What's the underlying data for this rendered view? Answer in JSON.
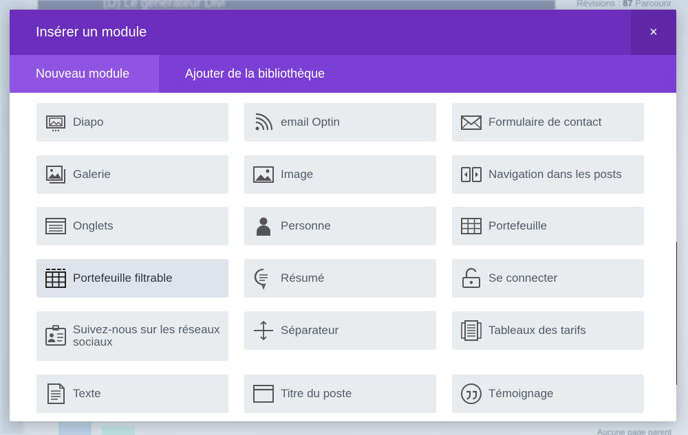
{
  "background": {
    "topbar_text": "(D) Le générateur Divi",
    "revisions_label": "Révisions",
    "revisions_count": "87",
    "revisions_more": "Parcourir",
    "bottom_note": "Aucune page parent"
  },
  "modal": {
    "title": "Insérer un module",
    "close_label": "×",
    "tabs": [
      {
        "label": "Nouveau module",
        "active": true
      },
      {
        "label": "Ajouter de la bibliothèque",
        "active": false
      }
    ],
    "modules": [
      {
        "label": "Diapo",
        "icon": "slider-icon"
      },
      {
        "label": "email Optin",
        "icon": "rss-icon"
      },
      {
        "label": "Formulaire de contact",
        "icon": "envelope-icon"
      },
      {
        "label": "Galerie",
        "icon": "gallery-icon"
      },
      {
        "label": "Image",
        "icon": "image-icon"
      },
      {
        "label": "Navigation dans les posts",
        "icon": "post-navigation-icon"
      },
      {
        "label": "Onglets",
        "icon": "tabs-icon"
      },
      {
        "label": "Personne",
        "icon": "person-icon"
      },
      {
        "label": "Portefeuille",
        "icon": "grid-icon"
      },
      {
        "label": "Portefeuille filtrable",
        "icon": "filterable-grid-icon",
        "selected": true
      },
      {
        "label": "Résumé",
        "icon": "speech-bubble-icon"
      },
      {
        "label": "Se connecter",
        "icon": "unlock-icon"
      },
      {
        "label": "Suivez-nous sur les réseaux sociaux",
        "icon": "social-follow-icon"
      },
      {
        "label": "Séparateur",
        "icon": "divider-icon"
      },
      {
        "label": "Tableaux des tarifs",
        "icon": "pricing-table-icon"
      },
      {
        "label": "Texte",
        "icon": "text-icon"
      },
      {
        "label": "Titre du poste",
        "icon": "post-title-icon"
      },
      {
        "label": "Témoignage",
        "icon": "quote-icon"
      }
    ]
  }
}
